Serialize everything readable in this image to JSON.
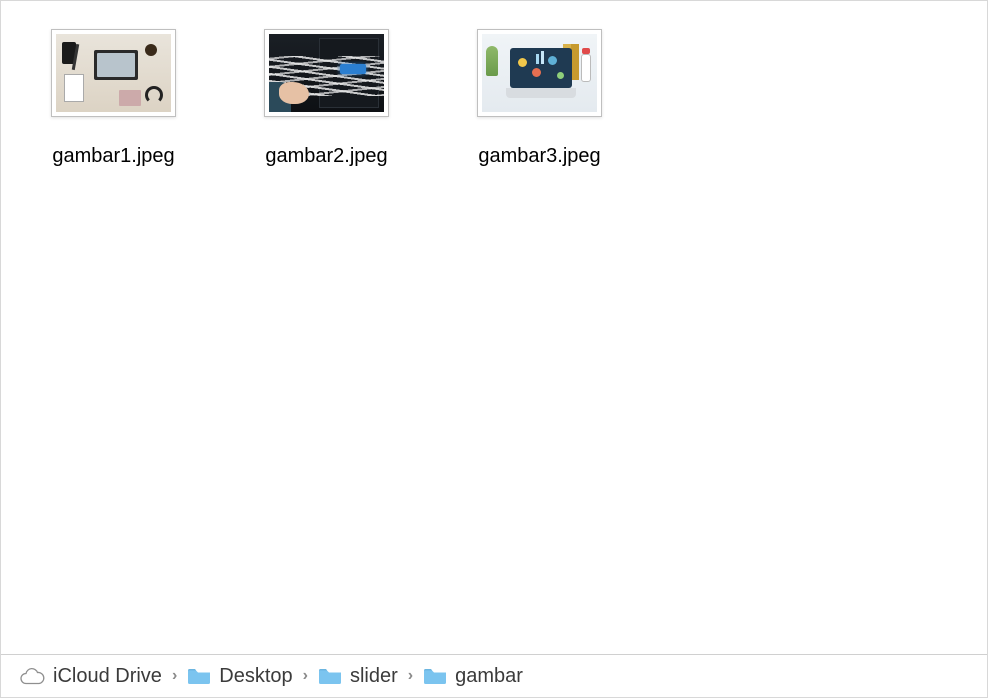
{
  "files": [
    {
      "name": "gambar1.jpeg",
      "thumb_desc": "desk-flatlay"
    },
    {
      "name": "gambar2.jpeg",
      "thumb_desc": "server-cables"
    },
    {
      "name": "gambar3.jpeg",
      "thumb_desc": "laptop-dashboard"
    }
  ],
  "breadcrumb": {
    "items": [
      {
        "label": "iCloud Drive",
        "icon": "cloud-icon"
      },
      {
        "label": "Desktop",
        "icon": "folder-icon"
      },
      {
        "label": "slider",
        "icon": "folder-icon"
      },
      {
        "label": "gambar",
        "icon": "folder-icon"
      }
    ],
    "separator": "›"
  },
  "colors": {
    "folder": "#7bc4ef",
    "folderTab": "#6bb5e0",
    "cloudStroke": "#8f8f8f"
  }
}
